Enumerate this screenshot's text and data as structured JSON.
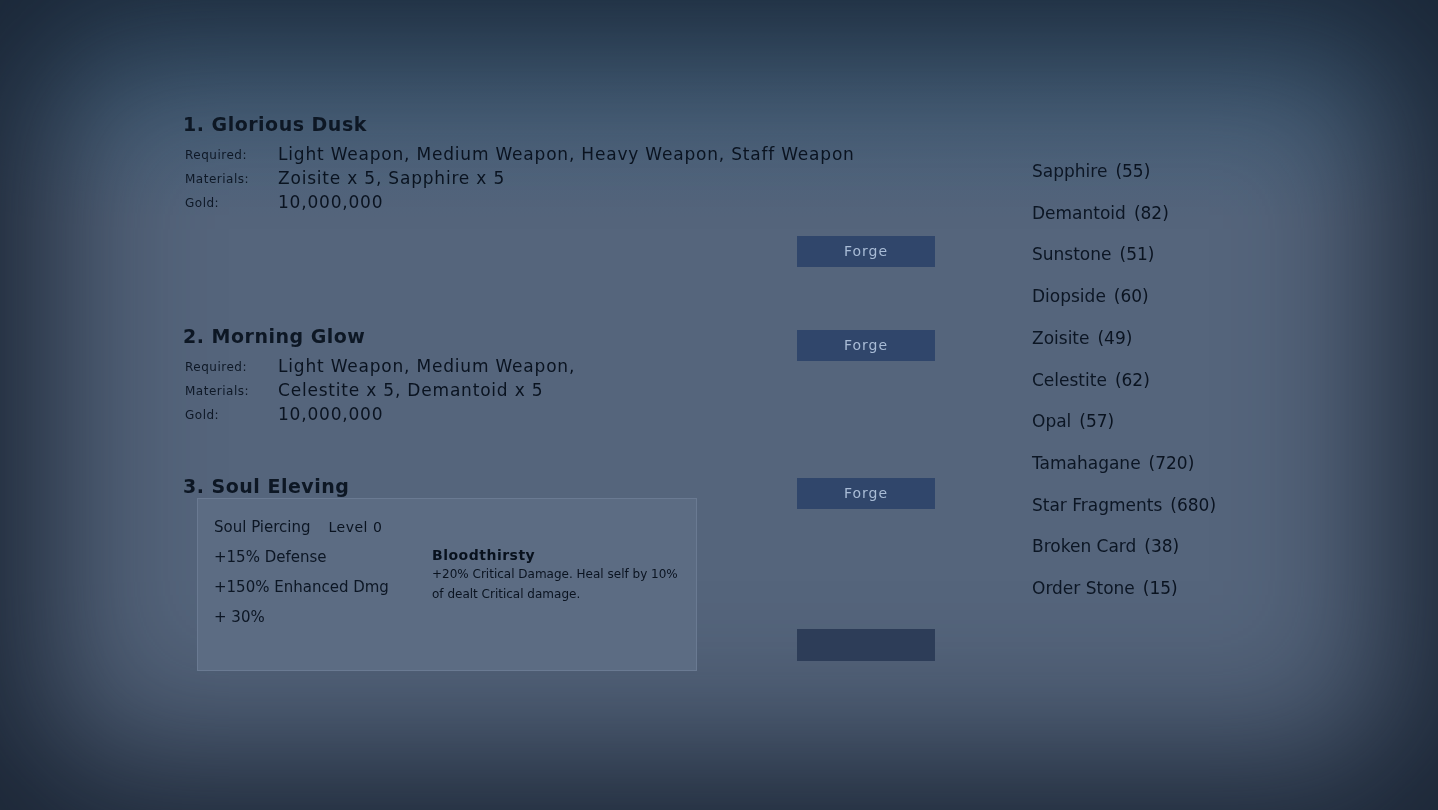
{
  "recipes": [
    {
      "title": "1. Glorious Dusk",
      "fields": [
        {
          "label": "Required:",
          "value": "Light Weapon, Medium Weapon, Heavy Weapon, Staff Weapon"
        },
        {
          "label": "Materials:",
          "value": "Zoisite x 5, Sapphire x 5"
        },
        {
          "label": "Gold:",
          "value": "10,000,000"
        }
      ]
    },
    {
      "title": "2. Morning Glow",
      "fields": [
        {
          "label": "Required:",
          "value": "Light Weapon, Medium Weapon,"
        },
        {
          "label": "Materials:",
          "value": "Celestite x 5, Demantoid x 5"
        },
        {
          "label": "Gold:",
          "value": "10,000,000"
        }
      ]
    },
    {
      "title": "3. Soul Eleving"
    }
  ],
  "forge_buttons": [
    {
      "kind": "labeled",
      "label": "Forge"
    },
    {
      "kind": "labeled",
      "label": "Forge"
    },
    {
      "kind": "labeled",
      "label": "Forge"
    },
    {
      "kind": "blank"
    }
  ],
  "skill_popup": {
    "skill": "Soul Piercing",
    "level": "Level 0",
    "bonuses": [
      "+15% Defense",
      "+150% Enhanced Dmg",
      "+ 30%"
    ],
    "effect": {
      "name": "Bloodthirsty",
      "description": "+20% Critical Damage. Heal self by 10% of dealt Critical damage."
    }
  },
  "materials": [
    {
      "name": "Sapphire",
      "count": "(55)"
    },
    {
      "name": "Demantoid",
      "count": "(82)"
    },
    {
      "name": "Sunstone",
      "count": "(51)"
    },
    {
      "name": "Diopside",
      "count": "(60)"
    },
    {
      "name": "Zoisite",
      "count": "(49)"
    },
    {
      "name": "Celestite",
      "count": "(62)"
    },
    {
      "name": "Opal",
      "count": "(57)"
    },
    {
      "name": "Tamahagane",
      "count": "(720)"
    },
    {
      "name": "Star Fragments",
      "count": "(680)"
    },
    {
      "name": "Broken Card",
      "count": "(38)"
    },
    {
      "name": "Order Stone",
      "count": "(15)"
    }
  ]
}
